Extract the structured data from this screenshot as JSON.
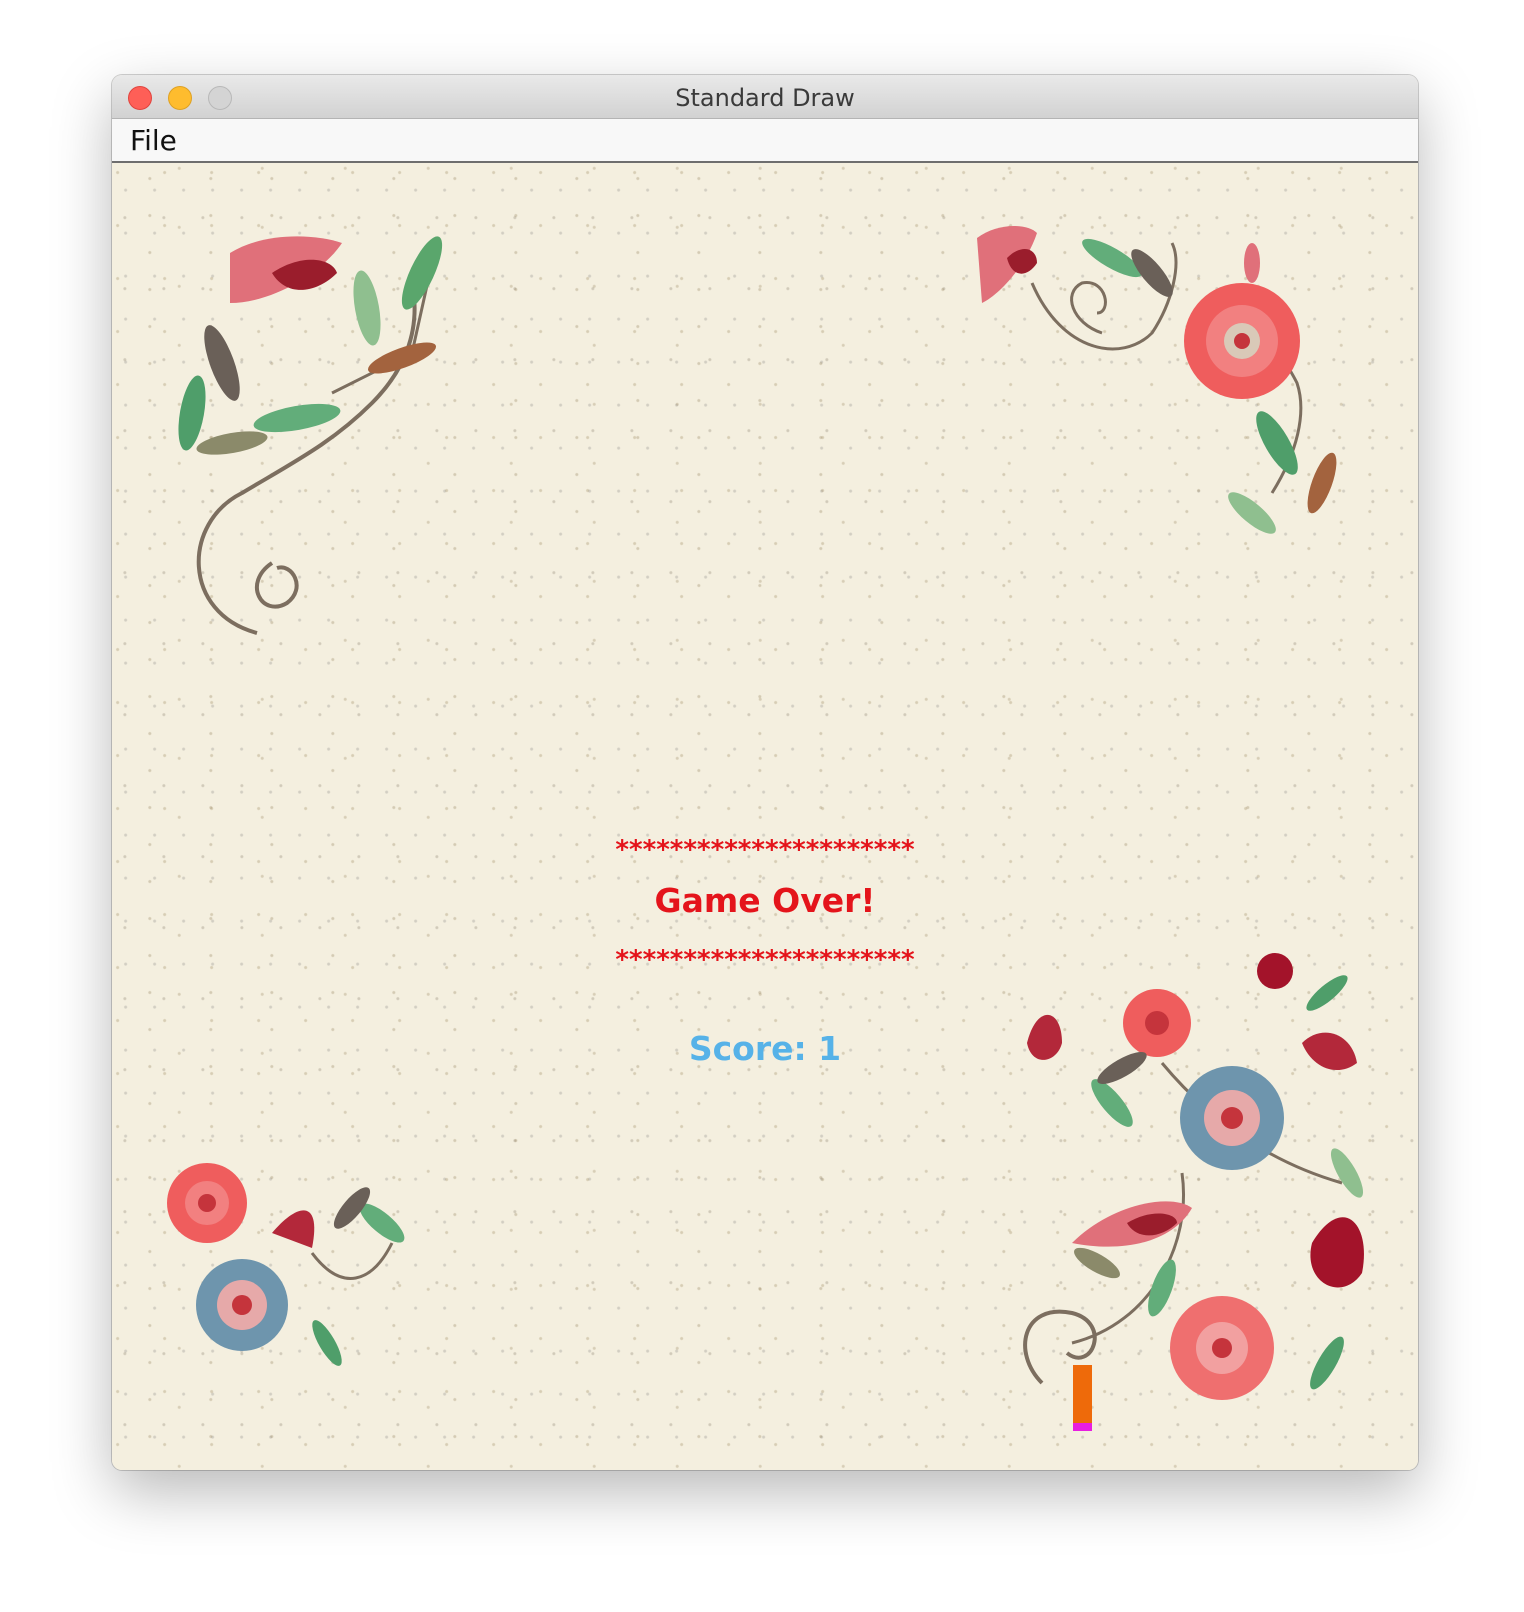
{
  "window": {
    "title": "Standard Draw"
  },
  "menubar": {
    "items": [
      {
        "label": "File"
      }
    ]
  },
  "game": {
    "stars_top": "**********************",
    "message": "Game Over!",
    "stars_bottom": "**********************",
    "score": "Score: 1"
  },
  "colors": {
    "message": "#e4141b",
    "score": "#56b2e8",
    "column_block": "#ee6a0a",
    "column_base": "#e81ee0"
  },
  "icons": {
    "close": "close-icon",
    "minimize": "minimize-icon",
    "zoom": "zoom-icon"
  }
}
